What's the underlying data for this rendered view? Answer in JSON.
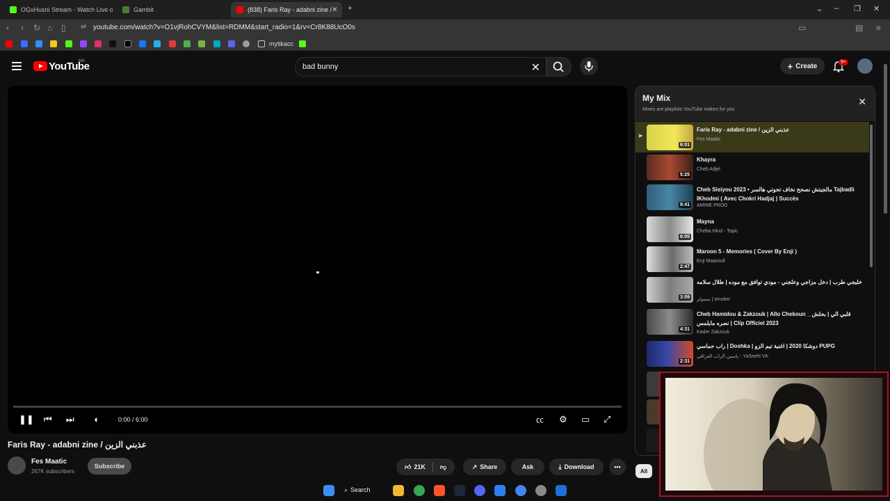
{
  "browser": {
    "tabs": [
      {
        "label": "OGxHusni Stream - Watch Live o",
        "color": "#53fc18"
      },
      {
        "label": "Gambit",
        "color": "#4a7c3a"
      },
      {
        "label": "(838) Faris Ray - adabni zine /",
        "color": "#ff0000"
      }
    ],
    "new_tab": "+",
    "url": "youtube.com/watch?v=O1vjRohCVYM&list=RDMM&start_radio=1&rv=Cr8K88UcO0s",
    "bookmark_folder": "mytikacc"
  },
  "header": {
    "logo_text": "YouTube",
    "country_code": "MA",
    "search_value": "bad bunny",
    "create_label": "Create",
    "notif_count": "9+"
  },
  "player": {
    "time": "0:00 / 6:00",
    "progress": 0
  },
  "video": {
    "title": "Faris Ray - adabni zine / عذبني الزين",
    "channel": "Fes Maatic",
    "subscribers": "267K subscribers",
    "subscribe_label": "Subscribe",
    "likes": "21K",
    "share_label": "Share",
    "ask_label": "Ask",
    "download_label": "Download"
  },
  "mix": {
    "title": "My Mix",
    "subtitle": "Mixes are playlists YouTube makes for you",
    "items": [
      {
        "title": "Faris Ray - adabni zine / عذبني الزين",
        "channel": "Fes Maatic",
        "duration": "6:01"
      },
      {
        "title": "Khayra",
        "channel": "Cheb Adjel",
        "duration": "5:25"
      },
      {
        "title": "Cheb Sisiyou 2023 • مالجيتش نصحح نخاف تحوتي هالسر Tajbadli lKhodmi ( Avec Chokri Hadjaj ) Succès",
        "channel": "AMINE PROD",
        "duration": "9:41"
      },
      {
        "title": "Mayna",
        "channel": "Cheba Hind - Topic",
        "duration": "6:05"
      },
      {
        "title": "Maroon 5 - Memories ( Cover By Enji )",
        "channel": "Enji Maaroufi",
        "duration": "2:47"
      },
      {
        "title": "خليجي طرب | دخل مزاجي وعلجني - مودي توافق مع موده | طلال سلامه",
        "channel": "سمولر | smoker",
        "duration": "3:09"
      },
      {
        "title": "Cheb Hamidou & Zakzouk | Allo Chekoun _ قلبي الي | بحلش نصره مايلمس | Clip Officiel 2023",
        "channel": "Kader Zakzouk",
        "duration": "4:31"
      },
      {
        "title": "راب حماسي | Doshka | دوشكا 2020 | اغنية تيم الزو PUPG",
        "channel": "ياسين الراب العراقي - YaSeeN VK",
        "duration": "2:31"
      }
    ]
  },
  "chips": {
    "all": "All"
  },
  "taskbar": {
    "search_label": "Search"
  }
}
